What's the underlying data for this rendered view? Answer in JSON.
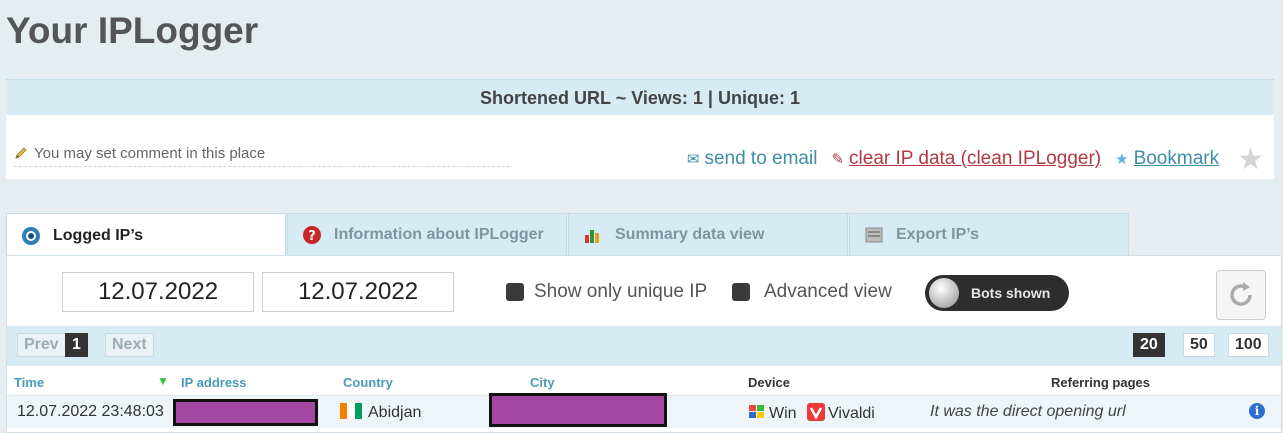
{
  "page_title": "Your IPLogger",
  "header_bar": "Shortened URL ~ Views: 1 | Unique: 1",
  "comment_placeholder": "You may set comment in this place",
  "actions": {
    "send_email": "send to email",
    "clear_data": "clear IP data (clean IPLogger)",
    "bookmark": "Bookmark"
  },
  "tabs": [
    {
      "label": "Logged IP’s",
      "icon": "eye-icon",
      "active": true
    },
    {
      "label": "Information about IPLogger",
      "icon": "question-icon",
      "active": false
    },
    {
      "label": "Summary data view",
      "icon": "bar-chart-icon",
      "active": false
    },
    {
      "label": "Export IP’s",
      "icon": "export-icon",
      "active": false
    }
  ],
  "filters": {
    "date_from": "12.07.2022",
    "date_to": "12.07.2022",
    "unique_only_label": "Show only unique IP",
    "advanced_view_label": "Advanced view",
    "bots_toggle_label": "Bots shown"
  },
  "pager": {
    "prev": "Prev",
    "page": "1",
    "next": "Next",
    "sizes": [
      "20",
      "50",
      "100"
    ],
    "active_size": "20"
  },
  "table": {
    "columns": [
      "Time",
      "IP address",
      "Country",
      "City",
      "Device",
      "Referring pages"
    ],
    "rows": [
      {
        "time": "12.07.2022 23:48:03",
        "country": "Abidjan",
        "country_flag_colors": [
          "#f77f00",
          "#ffffff",
          "#009e60"
        ],
        "os": "Win",
        "browser": "Vivaldi",
        "referrer": "It was the direct opening url"
      }
    ]
  },
  "colors": {
    "accent": "#3f8ea9",
    "clear_link": "#b03a44",
    "header_bg": "#d6ebf3",
    "redaction": "#a347a3"
  }
}
